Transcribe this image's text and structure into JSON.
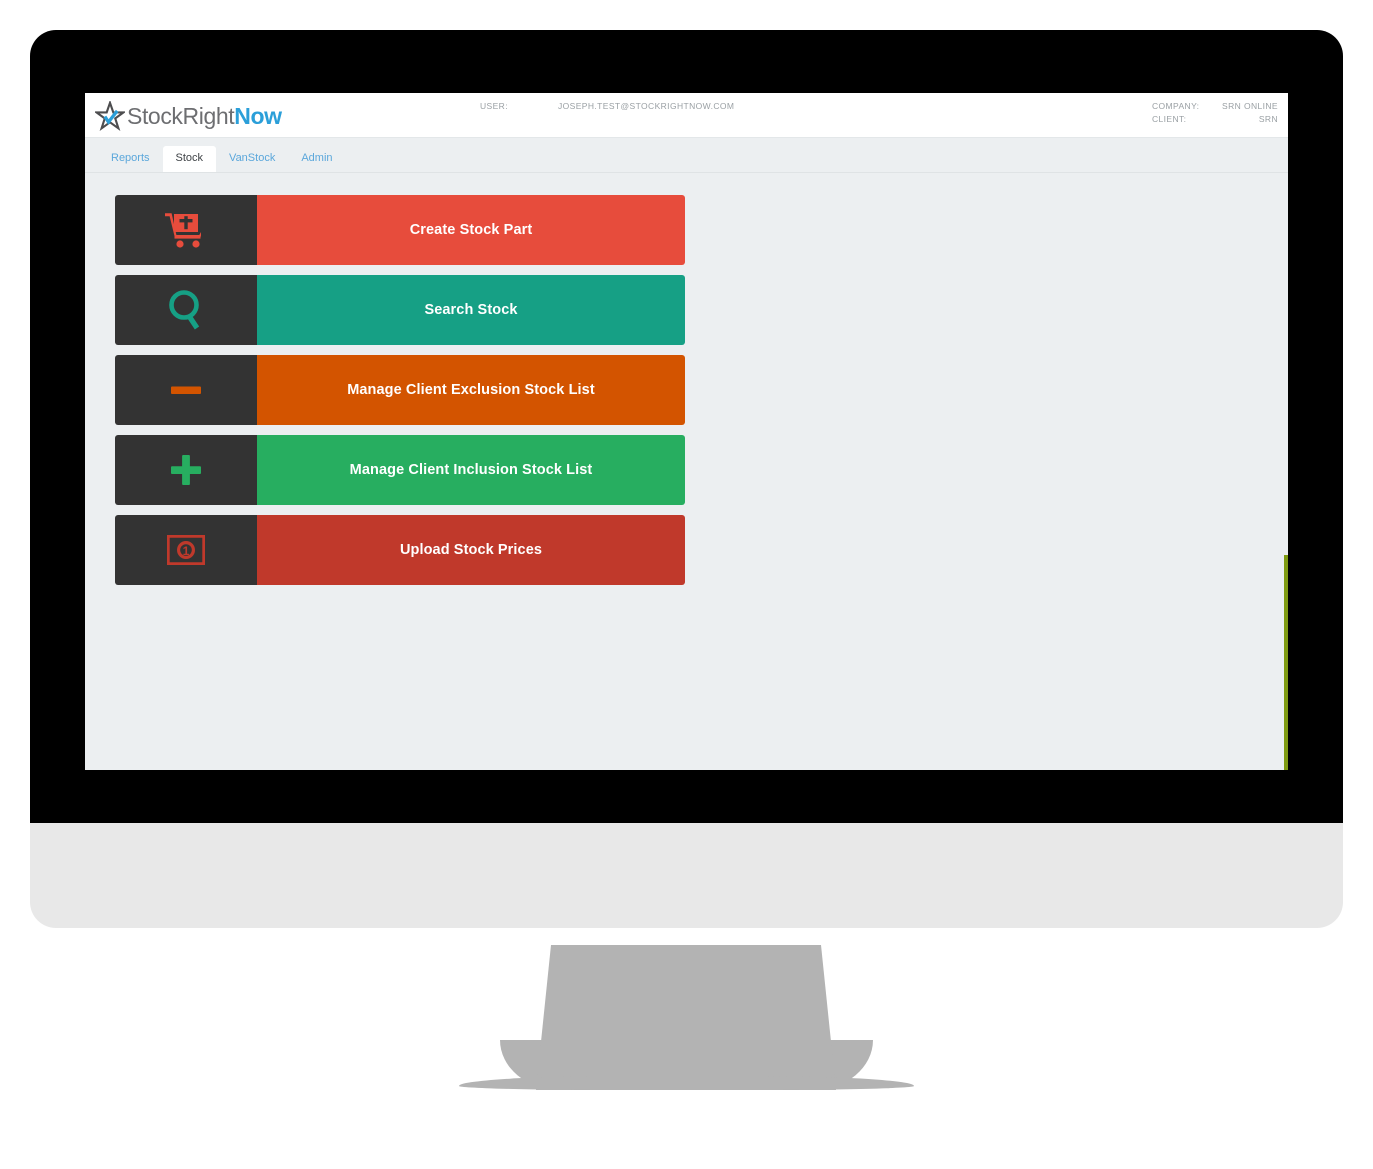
{
  "device": {
    "type": "desktop-monitor-mockup",
    "bezel_color": "#000000",
    "chin_color": "#e8e8e8",
    "stand_color": "#b3b3b3"
  },
  "screen": {
    "background": "#eceff1",
    "edge_strip_color": "#7f9b12"
  },
  "header": {
    "brand": {
      "part1": "Stock",
      "part2": "Right",
      "part3": "Now",
      "accent_color": "#2b9fd9",
      "text_color": "#6d6e71",
      "star_icon": "star-logo-icon"
    },
    "user": {
      "label": "USER:",
      "value": "JOSEPH.TEST@STOCKRIGHTNOW.COM"
    },
    "account": {
      "company_label": "COMPANY:",
      "company_value": "SRN ONLINE",
      "client_label": "CLIENT:",
      "client_value": "SRN"
    }
  },
  "nav": {
    "tabs": [
      {
        "label": "Reports",
        "active": false
      },
      {
        "label": "Stock",
        "active": true
      },
      {
        "label": "VanStock",
        "active": false
      },
      {
        "label": "Admin",
        "active": false
      }
    ]
  },
  "main": {
    "tiles": [
      {
        "label": "Create Stock Part",
        "icon": "cart-plus-icon",
        "color": "#e74c3c",
        "icon_panel_color": "#333333"
      },
      {
        "label": "Search Stock",
        "icon": "search-icon",
        "color": "#16a085",
        "icon_panel_color": "#333333"
      },
      {
        "label": "Manage Client Exclusion Stock List",
        "icon": "minus-icon",
        "color": "#d35400",
        "icon_panel_color": "#333333"
      },
      {
        "label": "Manage Client Inclusion Stock List",
        "icon": "plus-icon",
        "color": "#27ae60",
        "icon_panel_color": "#333333"
      },
      {
        "label": "Upload Stock Prices",
        "icon": "banknote-icon",
        "color": "#c0392b",
        "icon_panel_color": "#333333"
      }
    ]
  }
}
